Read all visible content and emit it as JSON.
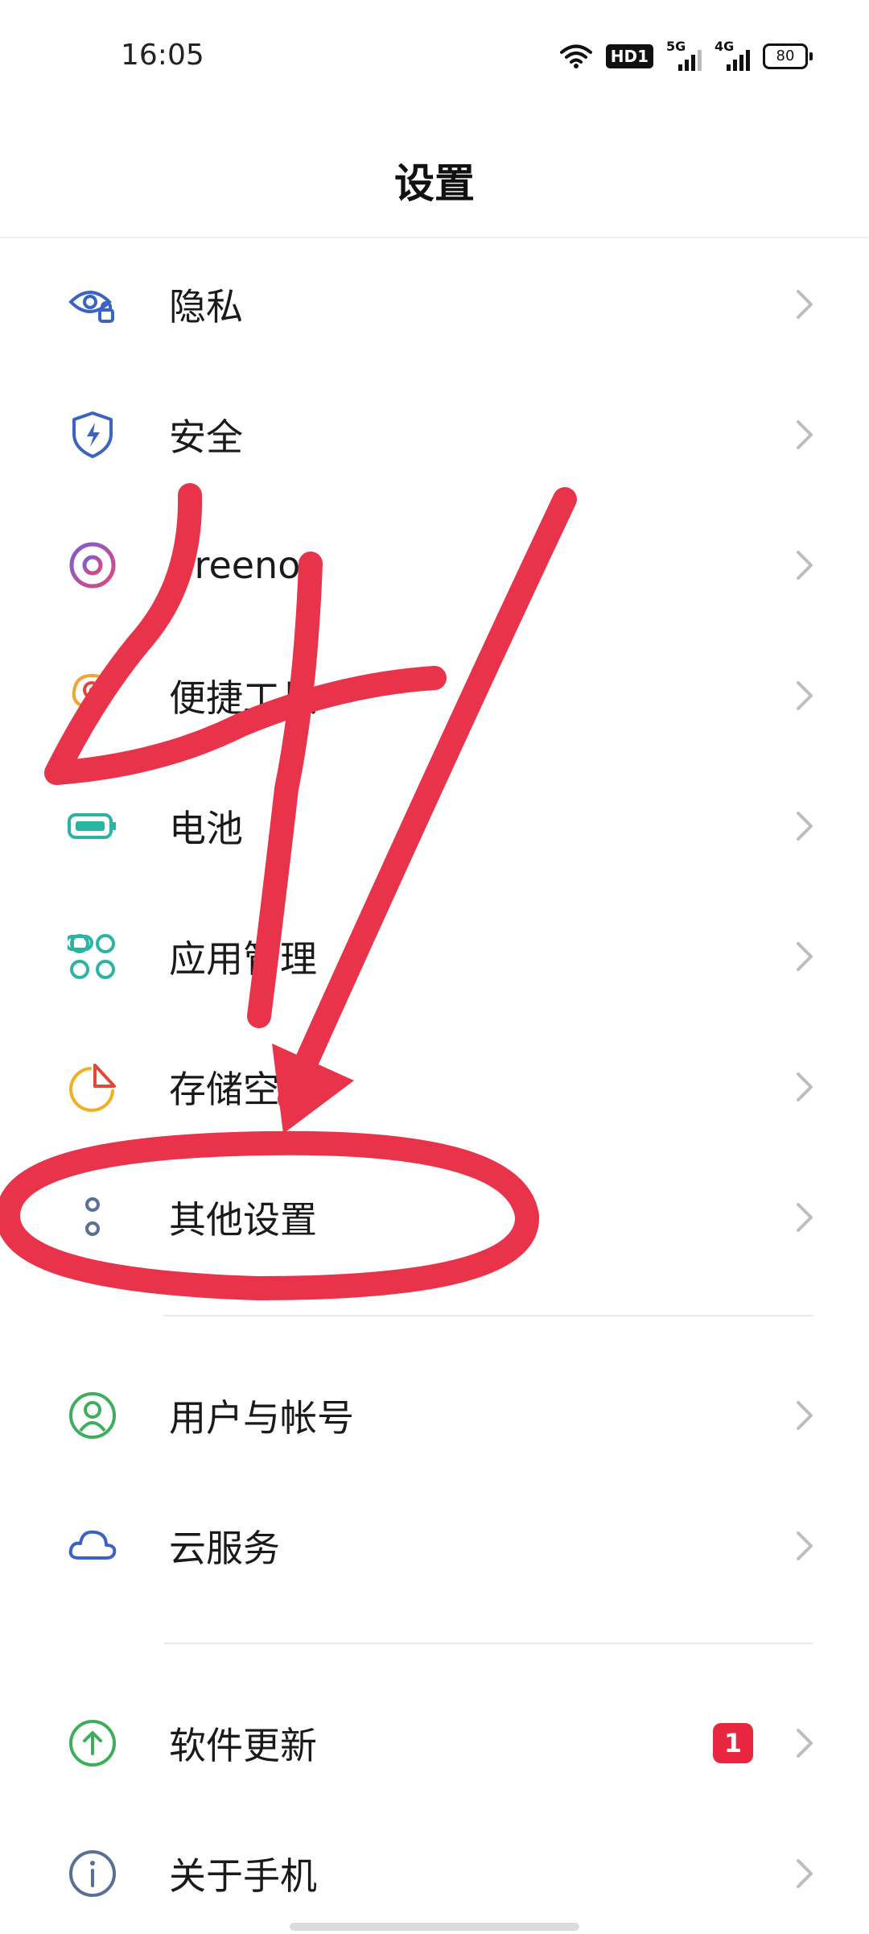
{
  "status_bar": {
    "time": "16:05",
    "hd_label": "HD1",
    "net1": "5G",
    "net2": "4G",
    "battery": "80"
  },
  "header": {
    "title": "设置"
  },
  "menu_groups": [
    [
      {
        "label": "隐私",
        "icon": "privacy-icon"
      },
      {
        "label": "安全",
        "icon": "security-shield-icon"
      },
      {
        "label": "Breeno",
        "icon": "breeno-icon"
      },
      {
        "label": "便捷工具",
        "icon": "convenience-tools-icon"
      },
      {
        "label": "电池",
        "icon": "battery-icon"
      },
      {
        "label": "应用管理",
        "icon": "app-management-icon"
      },
      {
        "label": "存储空间",
        "icon": "storage-icon"
      },
      {
        "label": "其他设置",
        "icon": "more-settings-icon"
      }
    ],
    [
      {
        "label": "用户与帐号",
        "icon": "user-account-icon"
      },
      {
        "label": "云服务",
        "icon": "cloud-icon"
      }
    ],
    [
      {
        "label": "软件更新",
        "icon": "update-icon",
        "badge": "1"
      },
      {
        "label": "关于手机",
        "icon": "info-icon"
      }
    ]
  ],
  "colors": {
    "accent_red": "#e8263f",
    "annotation_red": "#e8334a"
  }
}
